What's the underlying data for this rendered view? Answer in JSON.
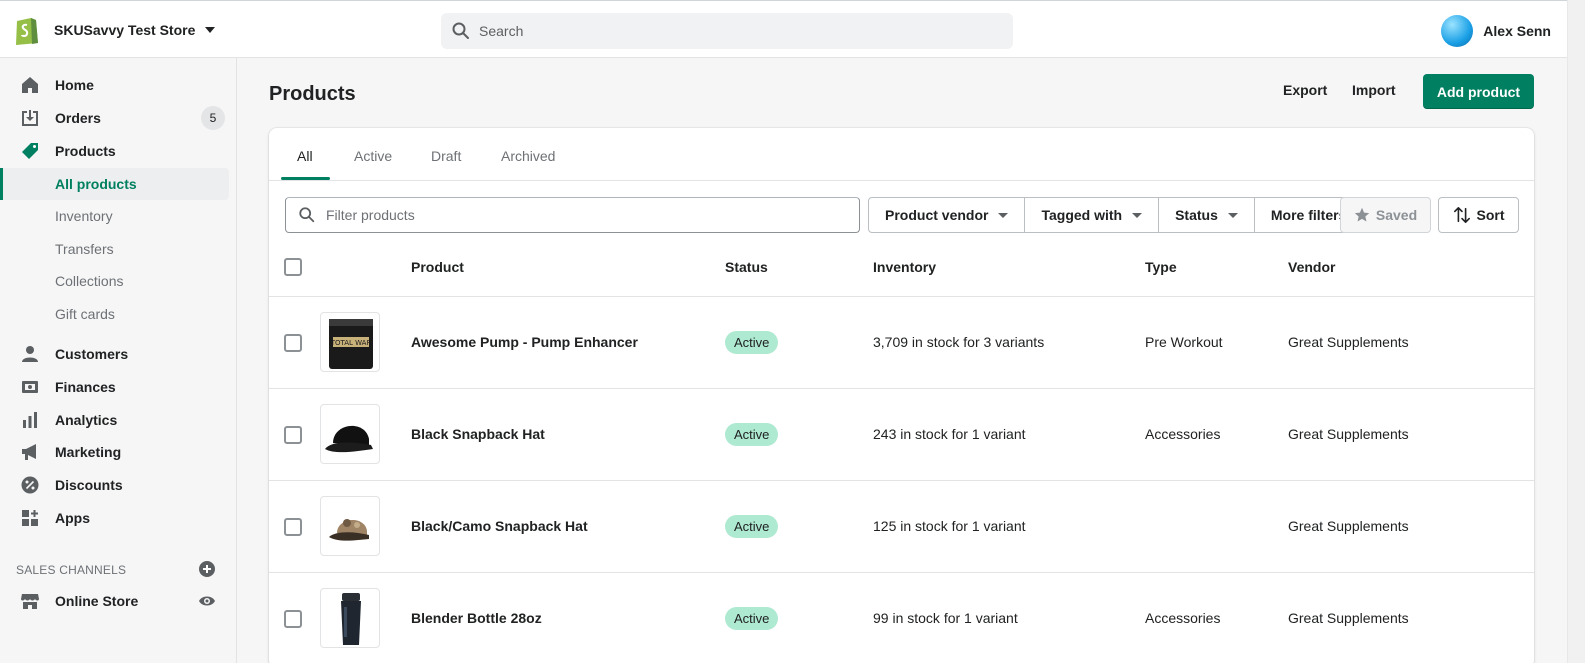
{
  "topbar": {
    "store_name": "SKUSavvy Test Store",
    "search_placeholder": "Search",
    "user_name": "Alex Senn"
  },
  "sidebar": {
    "items": [
      {
        "label": "Home",
        "icon": "home-icon"
      },
      {
        "label": "Orders",
        "icon": "orders-icon",
        "badge": "5"
      },
      {
        "label": "Products",
        "icon": "tag-icon"
      },
      {
        "label": "Customers",
        "icon": "person-icon"
      },
      {
        "label": "Finances",
        "icon": "finances-icon"
      },
      {
        "label": "Analytics",
        "icon": "bar-chart-icon"
      },
      {
        "label": "Marketing",
        "icon": "megaphone-icon"
      },
      {
        "label": "Discounts",
        "icon": "discount-icon"
      },
      {
        "label": "Apps",
        "icon": "apps-icon"
      }
    ],
    "product_subitems": [
      "All products",
      "Inventory",
      "Transfers",
      "Collections",
      "Gift cards"
    ],
    "active_subitem": "All products",
    "sales_channels_title": "SALES CHANNELS",
    "online_store_label": "Online Store"
  },
  "header": {
    "title": "Products",
    "export_label": "Export",
    "import_label": "Import",
    "add_label": "Add product"
  },
  "tabs": [
    "All",
    "Active",
    "Draft",
    "Archived"
  ],
  "selected_tab": "All",
  "filters": {
    "placeholder": "Filter products",
    "vendor": "Product vendor",
    "tagged": "Tagged with",
    "status": "Status",
    "more": "More filters",
    "saved": "Saved",
    "sort": "Sort"
  },
  "table": {
    "columns": [
      "Product",
      "Status",
      "Inventory",
      "Type",
      "Vendor"
    ],
    "rows": [
      {
        "name": "Awesome Pump - Pump Enhancer",
        "status": "Active",
        "inventory": "3,709 in stock for 3 variants",
        "type": "Pre Workout",
        "vendor": "Great Supplements",
        "thumb": "supplement-tub"
      },
      {
        "name": "Black Snapback Hat",
        "status": "Active",
        "inventory": "243 in stock for 1 variant",
        "type": "Accessories",
        "vendor": "Great Supplements",
        "thumb": "black-cap"
      },
      {
        "name": "Black/Camo Snapback Hat",
        "status": "Active",
        "inventory": "125 in stock for 1 variant",
        "type": "",
        "vendor": "Great Supplements",
        "thumb": "camo-cap"
      },
      {
        "name": "Blender Bottle 28oz",
        "status": "Active",
        "inventory": "99 in stock for 1 variant",
        "type": "Accessories",
        "vendor": "Great Supplements",
        "thumb": "shaker-bottle"
      }
    ]
  },
  "colors": {
    "accent": "#008060",
    "active_badge": "#aee9d1"
  }
}
